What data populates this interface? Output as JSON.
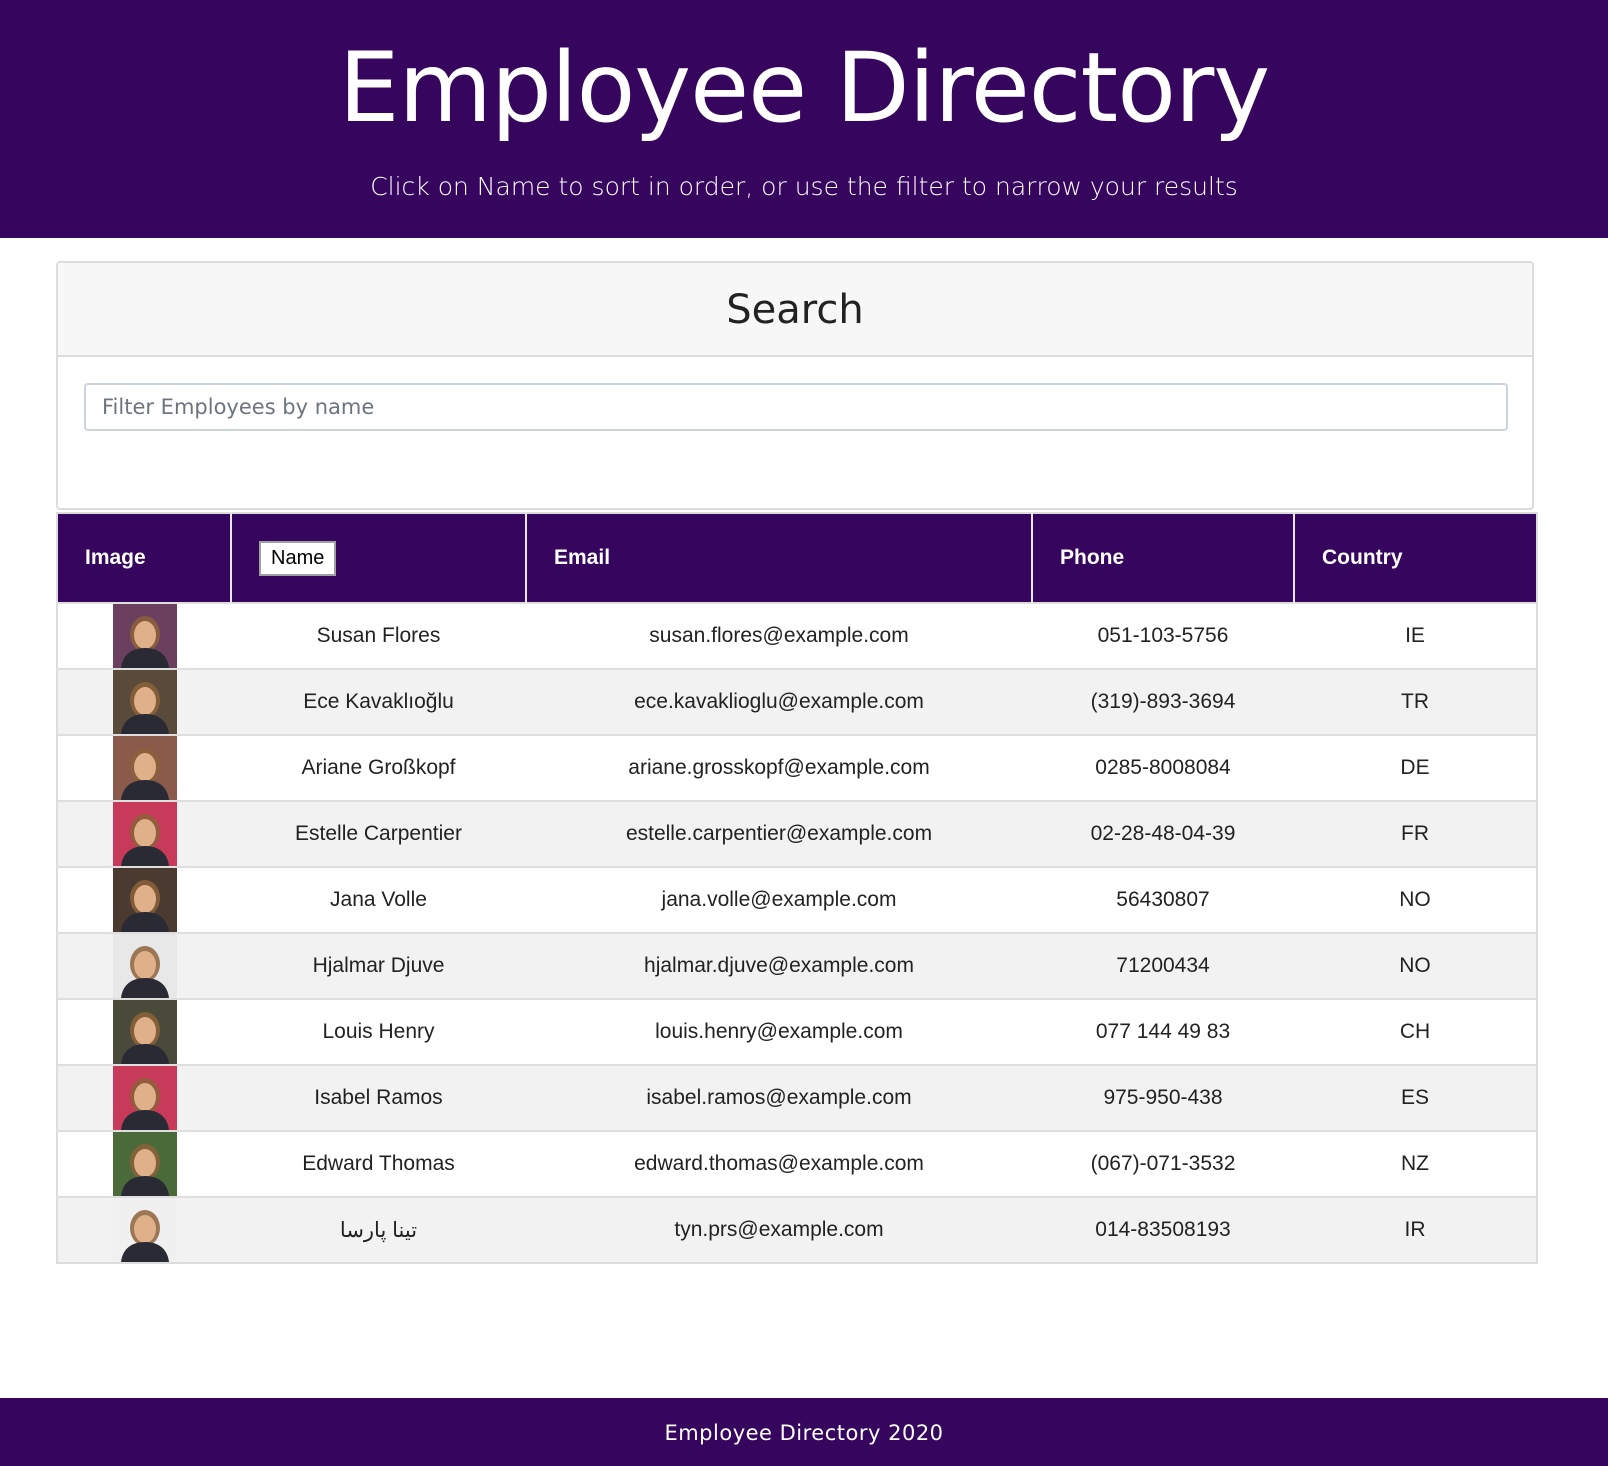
{
  "header": {
    "title": "Employee Directory",
    "subtitle": "Click on Name to sort in order, or use the filter to narrow your results"
  },
  "search": {
    "title": "Search",
    "placeholder": "Filter Employees by name",
    "value": ""
  },
  "table": {
    "columns": {
      "image": "Image",
      "name": "Name",
      "email": "Email",
      "phone": "Phone",
      "country": "Country"
    },
    "rows": [
      {
        "name": "Susan Flores",
        "email": "susan.flores@example.com",
        "phone": "051-103-5756",
        "country": "IE",
        "avatar_color": "#6b3f5e"
      },
      {
        "name": "Ece Kavaklıoğlu",
        "email": "ece.kavaklioglu@example.com",
        "phone": "(319)-893-3694",
        "country": "TR",
        "avatar_color": "#5a4a3a"
      },
      {
        "name": "Ariane Großkopf",
        "email": "ariane.grosskopf@example.com",
        "phone": "0285-8008084",
        "country": "DE",
        "avatar_color": "#8a5a4a"
      },
      {
        "name": "Estelle Carpentier",
        "email": "estelle.carpentier@example.com",
        "phone": "02-28-48-04-39",
        "country": "FR",
        "avatar_color": "#c83a5a"
      },
      {
        "name": "Jana Volle",
        "email": "jana.volle@example.com",
        "phone": "56430807",
        "country": "NO",
        "avatar_color": "#4a3a30"
      },
      {
        "name": "Hjalmar Djuve",
        "email": "hjalmar.djuve@example.com",
        "phone": "71200434",
        "country": "NO",
        "avatar_color": "#e8e8e8"
      },
      {
        "name": "Louis Henry",
        "email": "louis.henry@example.com",
        "phone": "077 144 49 83",
        "country": "CH",
        "avatar_color": "#4a4a3a"
      },
      {
        "name": "Isabel Ramos",
        "email": "isabel.ramos@example.com",
        "phone": "975-950-438",
        "country": "ES",
        "avatar_color": "#c83a5a"
      },
      {
        "name": "Edward Thomas",
        "email": "edward.thomas@example.com",
        "phone": "(067)-071-3532",
        "country": "NZ",
        "avatar_color": "#4a6a3a"
      },
      {
        "name": "تینا پارسا",
        "email": "tyn.prs@example.com",
        "phone": "014-83508193",
        "country": "IR",
        "avatar_color": "#f0f0f0"
      }
    ]
  },
  "footer": {
    "text": "Employee Directory 2020"
  },
  "colors": {
    "brand": "#36065e",
    "stripe": "#f2f2f2"
  }
}
